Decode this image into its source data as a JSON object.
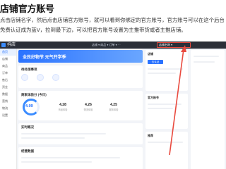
{
  "article": {
    "heading": "店铺官方账号",
    "paragraph": "点击店铺名字，然后点击店铺官方账号，就可以看到你绑定的官方账号，官方账号可以在这个后台免费认证成为蓝V，拉到最下边，可以把官方账号设置为主推带货或者主推店铺。"
  },
  "screenshot": {
    "app_name": "抖店",
    "top_nav": "店铺 ▾  商品 ▾  订单 ▾  ···",
    "shop_name": "店铺名称 ▾",
    "banner_text": "全民好物节  元气开学季",
    "sidebar_items": [
      "首页",
      "店铺",
      "商品",
      "订单",
      "售后",
      "资金",
      "数据",
      "营销",
      "物流",
      "设置"
    ],
    "cards": {
      "todo_title": "待处理事项",
      "score_title": "商家体验分 (今日)",
      "score_value": "4.09",
      "metrics": [
        {
          "value": "4.28",
          "label": "商品体验"
        },
        {
          "value": "4.26",
          "label": "物流体验"
        },
        {
          "value": "4.25",
          "label": "服务体验"
        }
      ],
      "stat_title": "实时概况",
      "data_title": "经营数据"
    },
    "right": {
      "r1_title": "店铺",
      "r1_button": "去认证",
      "r2_title": "官方账号",
      "r3_title": "推荐"
    },
    "colors": {
      "accent": "#2b73ff",
      "annotation": "#e94a3f"
    }
  }
}
